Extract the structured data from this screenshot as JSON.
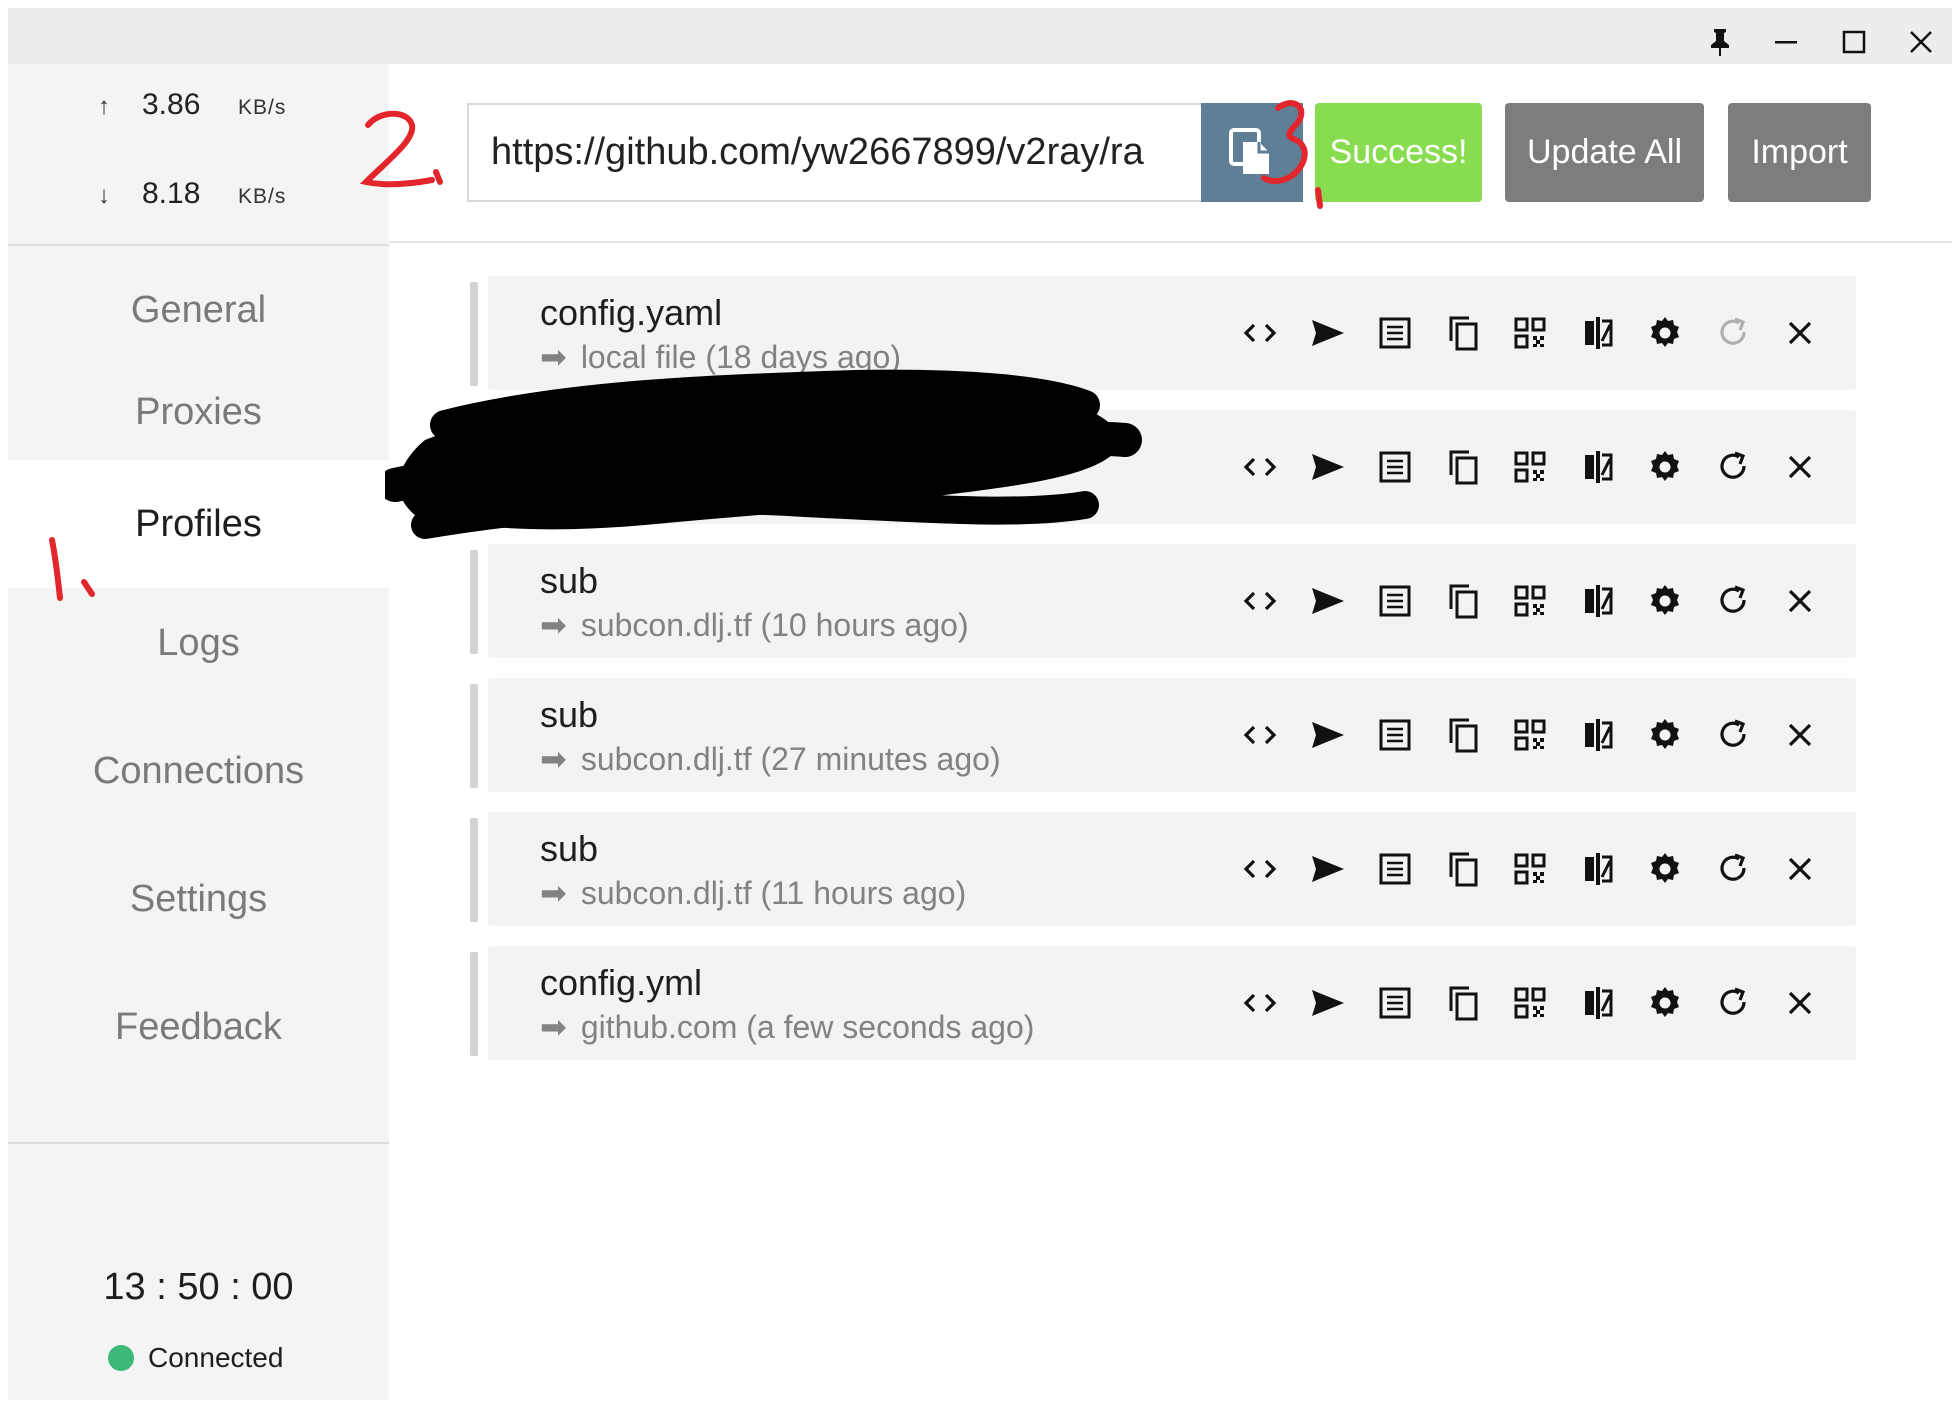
{
  "window": {
    "controls": [
      "pin-icon",
      "minimize-icon",
      "maximize-icon",
      "close-icon"
    ]
  },
  "traffic": {
    "up": {
      "arrow": "↑",
      "value": "3.86",
      "unit": "KB/s"
    },
    "down": {
      "arrow": "↓",
      "value": "8.18",
      "unit": "KB/s"
    }
  },
  "nav": {
    "items": [
      {
        "label": "General"
      },
      {
        "label": "Proxies"
      },
      {
        "label": "Profiles",
        "active": true
      },
      {
        "label": "Logs"
      },
      {
        "label": "Connections"
      },
      {
        "label": "Settings"
      },
      {
        "label": "Feedback"
      }
    ]
  },
  "footer": {
    "clock": "13 : 50 : 00",
    "status": "Connected",
    "status_color": "#3cb878"
  },
  "header": {
    "url_value": "https://github.com/yw2667899/v2ray/ra",
    "success_label": "Success!",
    "update_all_label": "Update All",
    "import_label": "Import"
  },
  "profiles": [
    {
      "name": "config.yaml",
      "icon": "➡",
      "source": "local file (18 days ago)",
      "update_enabled": false
    },
    {
      "name": "",
      "icon": "",
      "source": "",
      "update_enabled": true,
      "redacted": true
    },
    {
      "name": "sub",
      "icon": "➡",
      "source": "subcon.dlj.tf (10 hours ago)",
      "update_enabled": true
    },
    {
      "name": "sub",
      "icon": "➡",
      "source": "subcon.dlj.tf (27 minutes ago)",
      "update_enabled": true
    },
    {
      "name": "sub",
      "icon": "➡",
      "source": "subcon.dlj.tf (11 hours ago)",
      "update_enabled": true
    },
    {
      "name": "config.yml",
      "icon": "➡",
      "source": "github.com (a few seconds ago)",
      "update_enabled": true
    }
  ],
  "profile_actions": [
    "code-icon",
    "send-icon",
    "list-icon",
    "copy-icon",
    "qr-code-icon",
    "compare-icon",
    "settings-gear-icon",
    "refresh-icon",
    "delete-icon"
  ],
  "annotations": [
    "1.",
    "2.",
    "3."
  ],
  "colors": {
    "accent_success": "#88dc50",
    "button_gray": "#7d7d7d",
    "copy_button": "#5e7f96",
    "annotation_red": "#e3262b"
  }
}
